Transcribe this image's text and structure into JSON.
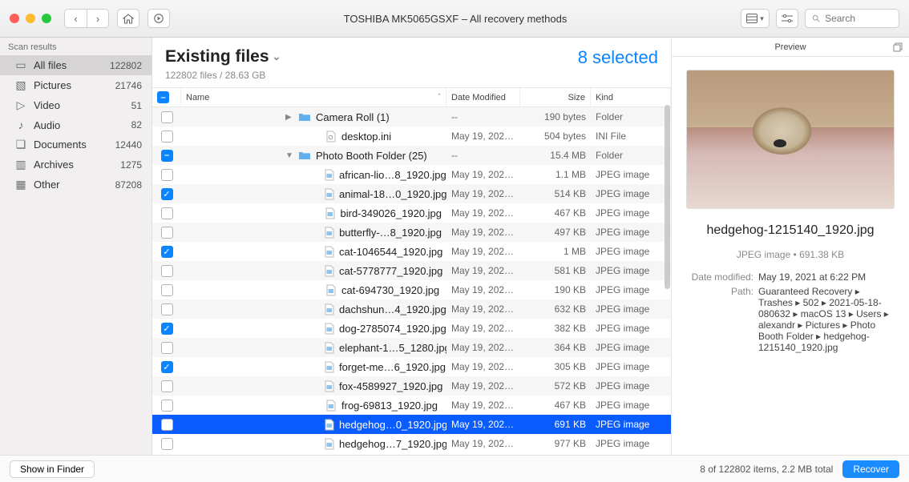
{
  "window": {
    "title": "TOSHIBA MK5065GSXF – All recovery methods"
  },
  "toolbar": {
    "search_placeholder": "Search"
  },
  "sidebar": {
    "heading": "Scan results",
    "items": [
      {
        "icon": "page",
        "label": "All files",
        "count": "122802",
        "active": true
      },
      {
        "icon": "pictures",
        "label": "Pictures",
        "count": "21746"
      },
      {
        "icon": "video",
        "label": "Video",
        "count": "51"
      },
      {
        "icon": "audio",
        "label": "Audio",
        "count": "82"
      },
      {
        "icon": "documents",
        "label": "Documents",
        "count": "12440"
      },
      {
        "icon": "archives",
        "label": "Archives",
        "count": "1275"
      },
      {
        "icon": "other",
        "label": "Other",
        "count": "87208"
      }
    ]
  },
  "main": {
    "title": "Existing files",
    "subtitle": "122802 files / 28.63 GB",
    "selected_label": "8 selected",
    "columns": {
      "name": "Name",
      "date": "Date Modified",
      "size": "Size",
      "kind": "Kind"
    },
    "header_check": "mix",
    "rows": [
      {
        "check": "",
        "indent": 0,
        "disclose": "▶",
        "icon": "folder",
        "name": "Camera Roll (1)",
        "date": "--",
        "size": "190 bytes",
        "kind": "Folder"
      },
      {
        "check": "",
        "indent": 1,
        "icon": "file",
        "name": "desktop.ini",
        "date": "May 19, 202…",
        "size": "504 bytes",
        "kind": "INI File"
      },
      {
        "check": "mix",
        "indent": 0,
        "disclose": "▼",
        "icon": "folder",
        "name": "Photo Booth Folder (25)",
        "date": "--",
        "size": "15.4 MB",
        "kind": "Folder"
      },
      {
        "check": "",
        "indent": 1,
        "icon": "img",
        "name": "african-lio…8_1920.jpg",
        "date": "May 19, 202…",
        "size": "1.1 MB",
        "kind": "JPEG image"
      },
      {
        "check": "on",
        "indent": 1,
        "icon": "img",
        "name": "animal-18…0_1920.jpg",
        "date": "May 19, 202…",
        "size": "514 KB",
        "kind": "JPEG image"
      },
      {
        "check": "",
        "indent": 1,
        "icon": "img",
        "name": "bird-349026_1920.jpg",
        "date": "May 19, 202…",
        "size": "467 KB",
        "kind": "JPEG image"
      },
      {
        "check": "",
        "indent": 1,
        "icon": "img",
        "name": "butterfly-…8_1920.jpg",
        "date": "May 19, 202…",
        "size": "497 KB",
        "kind": "JPEG image"
      },
      {
        "check": "on",
        "indent": 1,
        "icon": "img",
        "name": "cat-1046544_1920.jpg",
        "date": "May 19, 202…",
        "size": "1 MB",
        "kind": "JPEG image"
      },
      {
        "check": "",
        "indent": 1,
        "icon": "img",
        "name": "cat-5778777_1920.jpg",
        "date": "May 19, 202…",
        "size": "581 KB",
        "kind": "JPEG image"
      },
      {
        "check": "",
        "indent": 1,
        "icon": "img",
        "name": "cat-694730_1920.jpg",
        "date": "May 19, 202…",
        "size": "190 KB",
        "kind": "JPEG image"
      },
      {
        "check": "",
        "indent": 1,
        "icon": "img",
        "name": "dachshun…4_1920.jpg",
        "date": "May 19, 202…",
        "size": "632 KB",
        "kind": "JPEG image"
      },
      {
        "check": "on",
        "indent": 1,
        "icon": "img",
        "name": "dog-2785074_1920.jpg",
        "date": "May 19, 202…",
        "size": "382 KB",
        "kind": "JPEG image"
      },
      {
        "check": "",
        "indent": 1,
        "icon": "img",
        "name": "elephant-1…5_1280.jpg",
        "date": "May 19, 202…",
        "size": "364 KB",
        "kind": "JPEG image"
      },
      {
        "check": "on",
        "indent": 1,
        "icon": "img",
        "name": "forget-me…6_1920.jpg",
        "date": "May 19, 202…",
        "size": "305 KB",
        "kind": "JPEG image"
      },
      {
        "check": "",
        "indent": 1,
        "icon": "img",
        "name": "fox-4589927_1920.jpg",
        "date": "May 19, 202…",
        "size": "572 KB",
        "kind": "JPEG image"
      },
      {
        "check": "",
        "indent": 1,
        "icon": "img",
        "name": "frog-69813_1920.jpg",
        "date": "May 19, 202…",
        "size": "467 KB",
        "kind": "JPEG image"
      },
      {
        "check": "",
        "indent": 1,
        "icon": "img",
        "name": "hedgehog…0_1920.jpg",
        "date": "May 19, 202…",
        "size": "691 KB",
        "kind": "JPEG image",
        "selected": true
      },
      {
        "check": "",
        "indent": 1,
        "icon": "img",
        "name": "hedgehog…7_1920.jpg",
        "date": "May 19, 202…",
        "size": "977 KB",
        "kind": "JPEG image"
      }
    ]
  },
  "preview": {
    "heading": "Preview",
    "filename": "hedgehog-1215140_1920.jpg",
    "meta": "JPEG image • 691.38 KB",
    "date_label": "Date modified:",
    "date_value": "May 19, 2021 at 6:22 PM",
    "path_label": "Path:",
    "path_value": "Guaranteed Recovery ▸ Trashes ▸ 502 ▸ 2021-05-18-080632 ▸ macOS 13 ▸ Users ▸ alexandr ▸ Pictures ▸ Photo Booth Folder ▸ hedgehog-1215140_1920.jpg"
  },
  "footer": {
    "show_in_finder": "Show in Finder",
    "status": "8 of 122802 items, 2.2 MB total",
    "recover": "Recover"
  }
}
